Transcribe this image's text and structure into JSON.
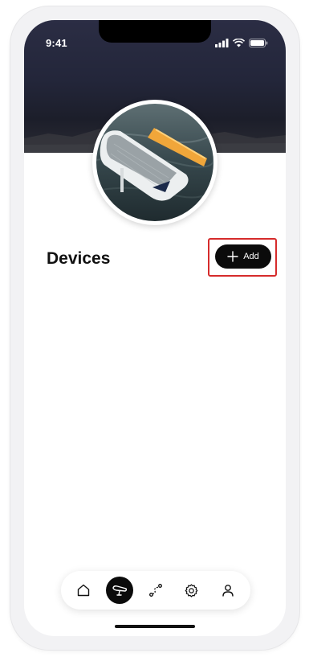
{
  "status_bar": {
    "time": "9:41",
    "icons": [
      "signal-icon",
      "wifi-icon",
      "battery-icon"
    ]
  },
  "header": {
    "avatar": "board-photo"
  },
  "devices": {
    "title": "Devices",
    "add_label": "Add",
    "add_icon": "plus-icon",
    "highlight_color": "#d62b2b"
  },
  "tabbar": {
    "items": [
      {
        "icon": "home-icon",
        "active": false
      },
      {
        "icon": "board-icon",
        "active": true
      },
      {
        "icon": "route-icon",
        "active": false
      },
      {
        "icon": "settings-icon",
        "active": false
      },
      {
        "icon": "profile-icon",
        "active": false
      }
    ]
  },
  "colors": {
    "hero_dark": "#23263a",
    "accent_black": "#0b0b0b",
    "board_orange": "#f0a63a"
  }
}
